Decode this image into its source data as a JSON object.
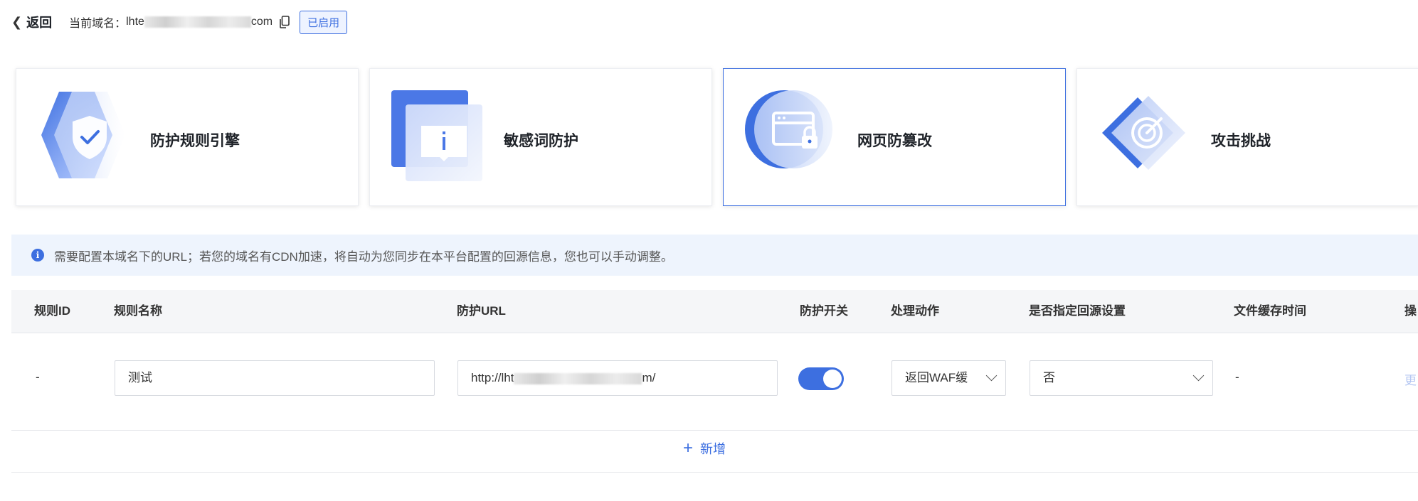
{
  "header": {
    "back_label": "返回",
    "domain_prefix": "当前域名：",
    "domain_start": "lhte",
    "domain_end": "com",
    "status": "已启用"
  },
  "cards": [
    {
      "title": "防护规则引擎",
      "icon": "shield-check-icon"
    },
    {
      "title": "敏感词防护",
      "icon": "info-message-icon"
    },
    {
      "title": "网页防篡改",
      "icon": "browser-lock-icon",
      "active": true
    },
    {
      "title": "攻击挑战",
      "icon": "target-icon"
    }
  ],
  "info": {
    "text": "需要配置本域名下的URL；若您的域名有CDN加速，将自动为您同步在本平台配置的回源信息，您也可以手动调整。"
  },
  "table": {
    "headers": [
      "规则ID",
      "规则名称",
      "防护URL",
      "防护开关",
      "处理动作",
      "是否指定回源设置",
      "文件缓存时间",
      "操"
    ],
    "rows": [
      {
        "id": "-",
        "name": "测试",
        "url_start": "http://lht",
        "url_end": "m/",
        "switch_on": true,
        "action": "返回WAF缓",
        "origin": "否",
        "cache": "-",
        "op": "更"
      }
    ]
  },
  "add_label": "新增",
  "colors": {
    "accent": "#3d6fe0",
    "info_bg": "#eef4fd",
    "header_bg": "#f5f6f8"
  }
}
